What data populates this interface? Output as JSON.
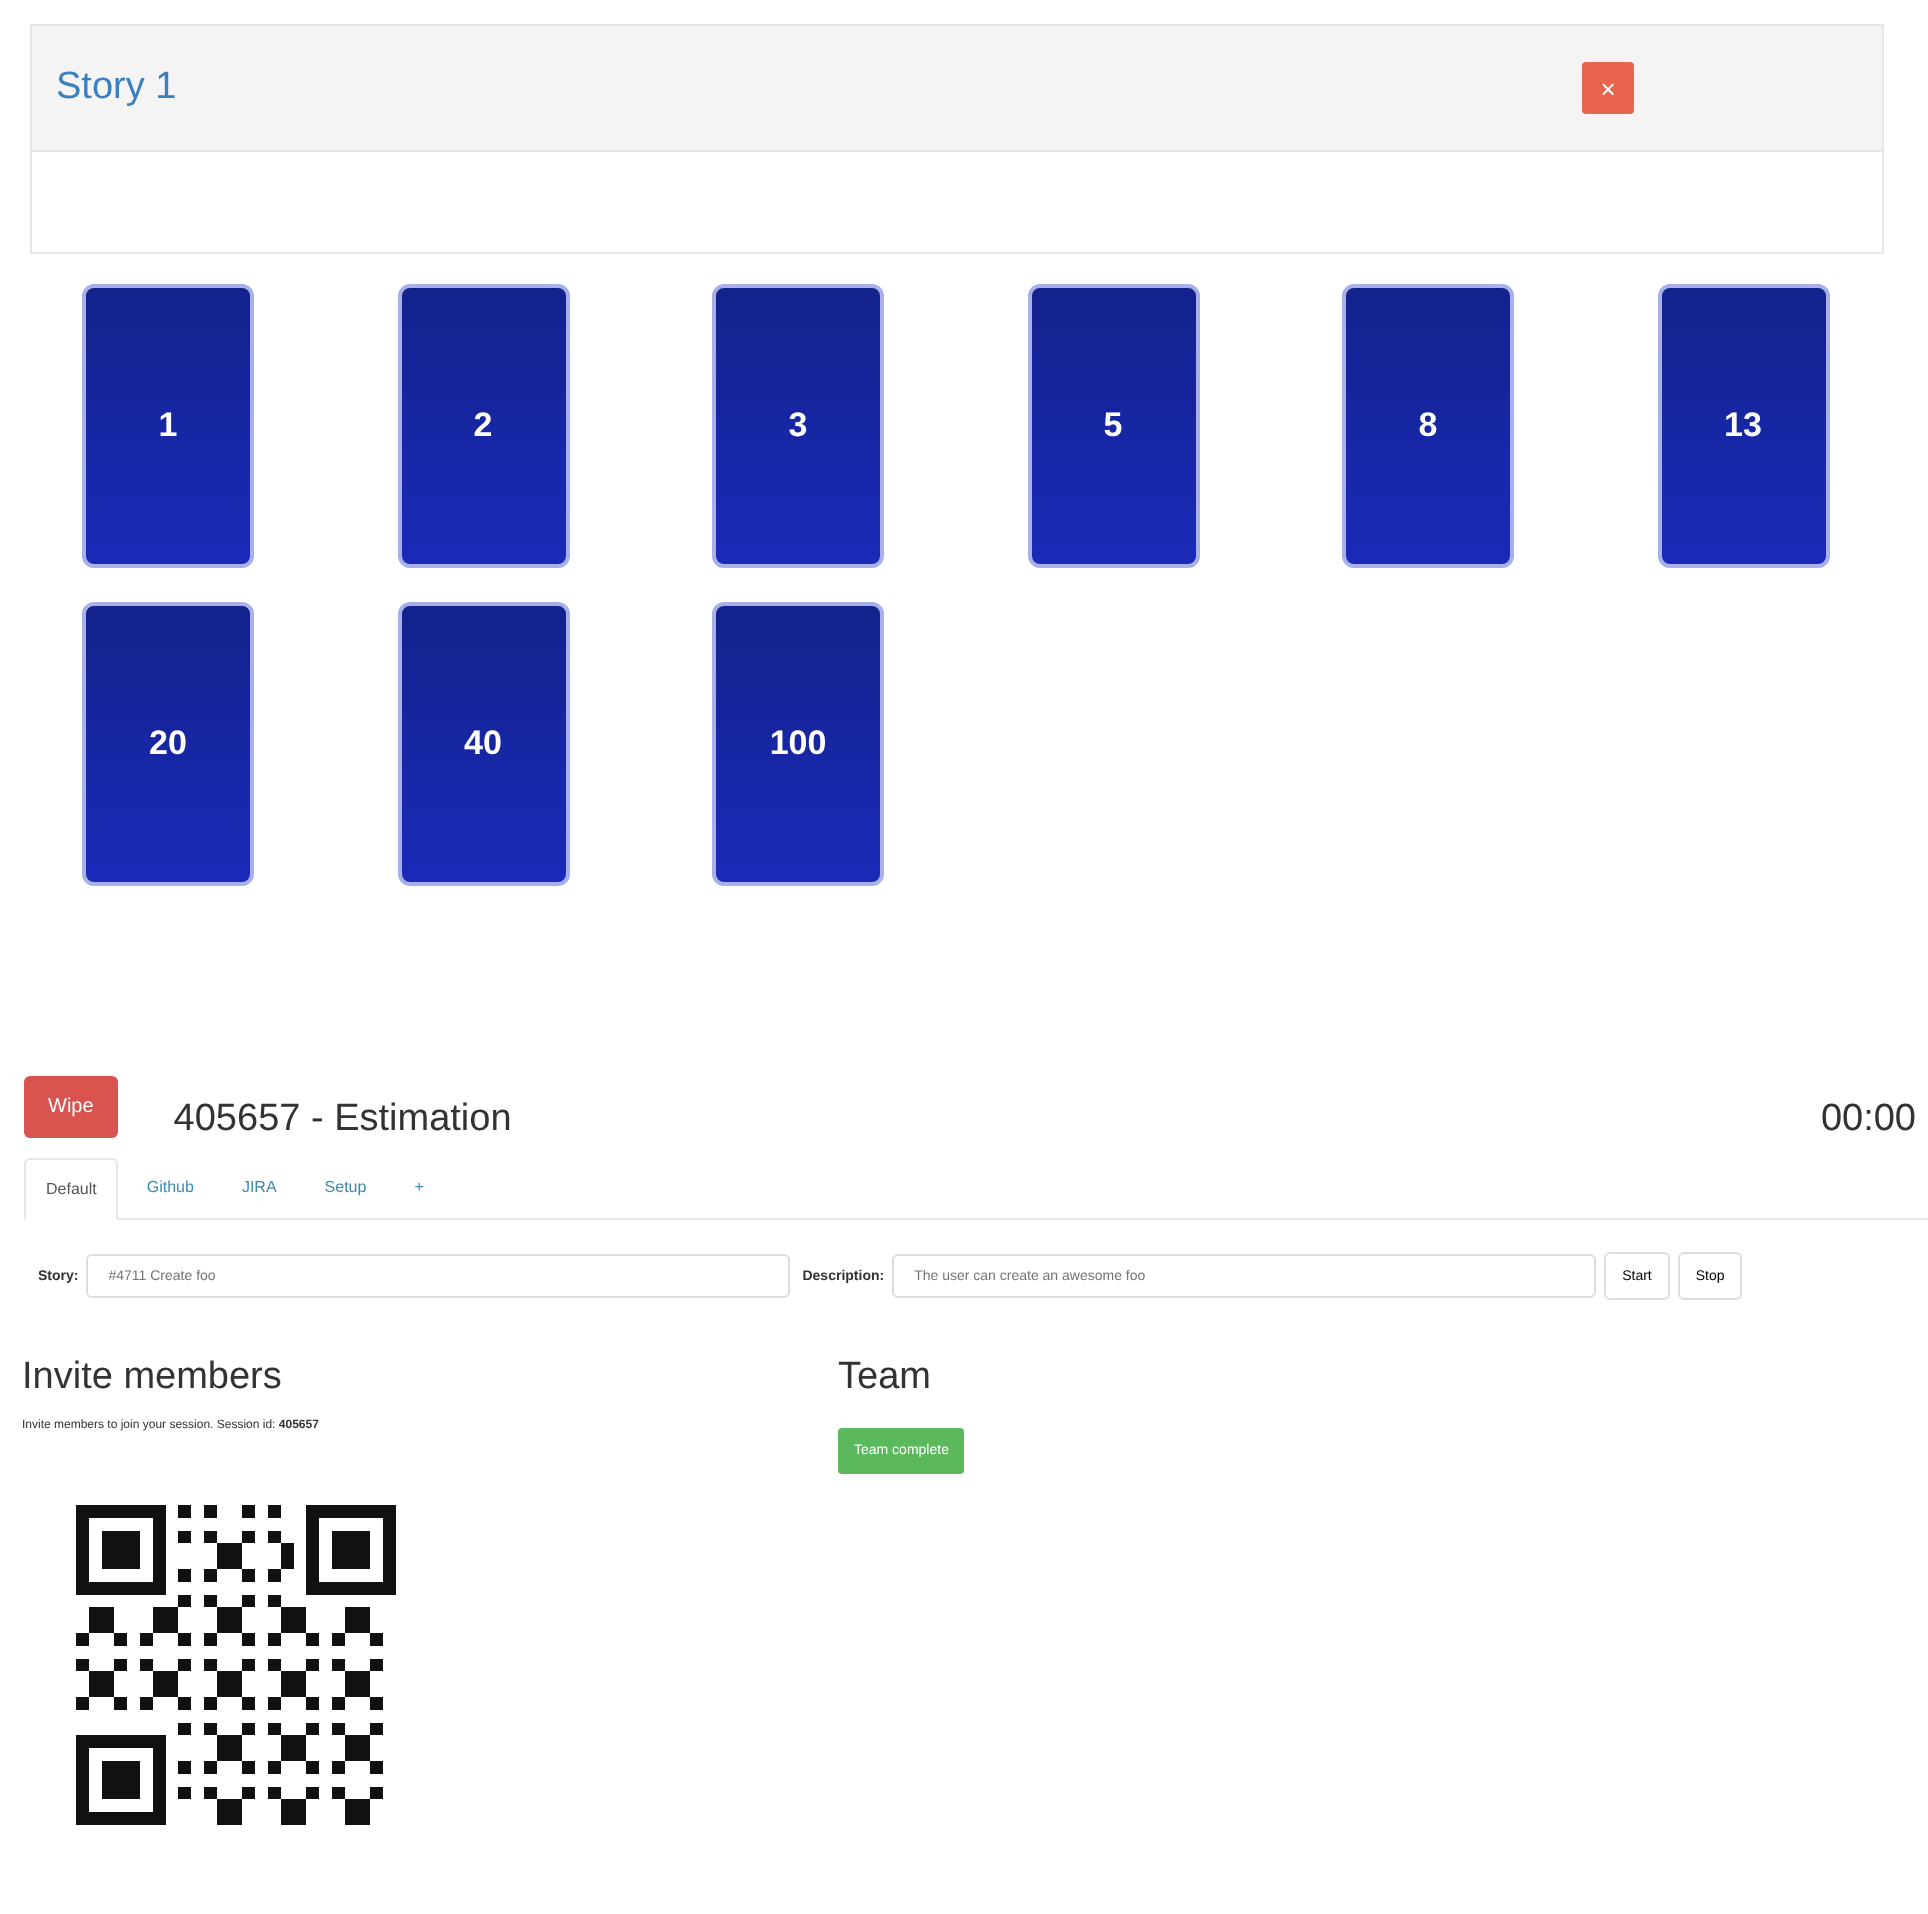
{
  "story": {
    "title": "Story 1",
    "close": "×"
  },
  "cards": [
    "1",
    "2",
    "3",
    "5",
    "8",
    "13",
    "20",
    "40",
    "100"
  ],
  "session": {
    "wipe": "Wipe",
    "title": "405657 - Estimation",
    "timer": "00:00"
  },
  "tabs": [
    {
      "label": "Default",
      "selected": true
    },
    {
      "label": "Github",
      "selected": false
    },
    {
      "label": "JIRA",
      "selected": false
    },
    {
      "label": "Setup",
      "selected": false
    },
    {
      "label": "+",
      "selected": false
    }
  ],
  "form": {
    "story_label": "Story:",
    "story_placeholder": "#4711 Create foo",
    "description_label": "Description:",
    "description_placeholder": "The user can create an awesome foo",
    "buttons": [
      "Start",
      "Stop"
    ]
  },
  "invite": {
    "heading": "Invite members",
    "text": "Invite members to join your session. Session id: **405657**"
  },
  "team": {
    "heading": "Team",
    "button": "Team complete"
  }
}
